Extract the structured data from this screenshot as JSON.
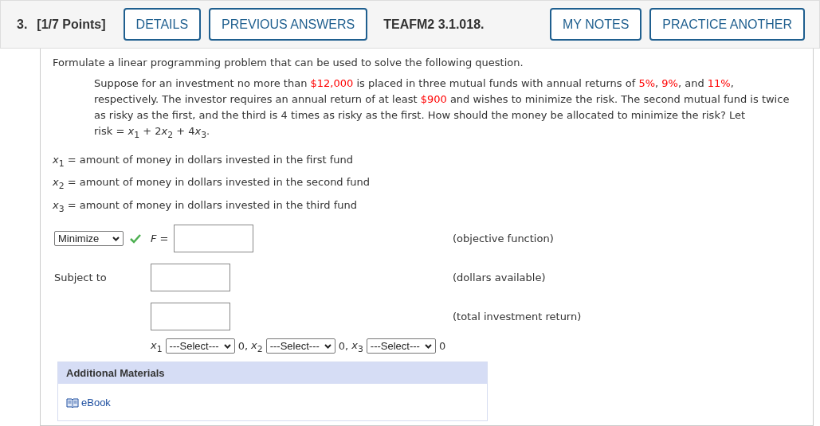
{
  "header": {
    "number": "3.",
    "points": "[1/7 Points]",
    "buttons": [
      {
        "label": "DETAILS"
      },
      {
        "label": "PREVIOUS ANSWERS"
      }
    ],
    "code": "TEAFM2 3.1.018.",
    "right_buttons": [
      {
        "label": "MY NOTES"
      },
      {
        "label": "PRACTICE ANOTHER"
      }
    ]
  },
  "instruction": "Formulate a linear programming problem that can be used to solve the following question.",
  "problem": [
    {
      "text": "Suppose for an investment no more than ",
      "highlight": false
    },
    {
      "text": "$12,000",
      "highlight": true
    },
    {
      "text": " is placed in three mutual funds with annual returns of ",
      "highlight": false
    },
    {
      "text": "5%",
      "highlight": true
    },
    {
      "text": ", ",
      "highlight": false
    },
    {
      "text": "9%",
      "highlight": true
    },
    {
      "text": ", and ",
      "highlight": false
    },
    {
      "text": "11%",
      "highlight": true
    },
    {
      "text": ", respectively. The investor requires an annual return of at least ",
      "highlight": false
    },
    {
      "text": "$900",
      "highlight": true
    },
    {
      "text": " and wishes to minimize the risk. The second mutual fund is twice as risky as the first, and the third is 4 times as risky as the first. How should the money be allocated to minimize the risk? Let ",
      "highlight": false
    }
  ],
  "risk_formula": [
    "risk = *x*$_{1}$ + 2",
    "*x*$_{2}$ + 4",
    "*x*$_{3}$."
  ],
  "variables": [
    "*x*$_{1}$ = amount of money in dollars invested in the first fund",
    "*x*$_{2}$ = amount of money in dollars invested in the second fund",
    "*x*$_{3}$ = amount of money in dollars invested in the third fund"
  ],
  "objective": {
    "select": "Minimize",
    "correct": true,
    "label": "*F* =",
    "comment": "(objective function)"
  },
  "subject_to": "Subject to",
  "constraints": [
    {
      "comment": "(dollars available)"
    },
    {
      "comment": "(total investment return)"
    }
  ],
  "nonnegativity": [
    {
      "var": "*x*$_{1}$",
      "select": "---Select---",
      "after": "0,"
    },
    {
      "var": "*x*$_{2}$",
      "select": "---Select---",
      "after": "0,"
    },
    {
      "var": "*x*$_{3}$",
      "select": "---Select---",
      "after": "0"
    }
  ],
  "materials": {
    "title": "Additional Materials",
    "link": "eBook"
  }
}
